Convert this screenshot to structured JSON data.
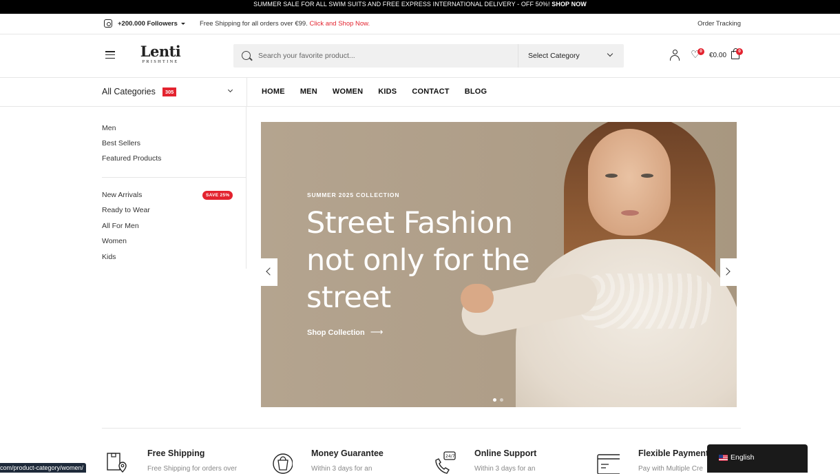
{
  "announcement": {
    "text": "SUMMER SALE FOR ALL SWIM SUITS AND FREE EXPRESS INTERNATIONAL DELIVERY - OFF 50%!",
    "cta": "SHOP NOW"
  },
  "infobar": {
    "followers": "+200.000 Followers",
    "shipping_text": "Free Shipping for all orders over €99.",
    "shipping_link": "Click and Shop Now.",
    "order_tracking": "Order Tracking"
  },
  "header": {
    "logo_main": "Lenti",
    "logo_sub": "PRISHTINE",
    "search_placeholder": "Search your favorite product...",
    "category_select": "Select Category",
    "wishlist_count": "0",
    "cart_total": "€0.00",
    "cart_count": "0"
  },
  "nav": {
    "all_categories": "All Categories",
    "category_count": "305",
    "menu": [
      "HOME",
      "MEN",
      "WOMEN",
      "KIDS",
      "CONTACT",
      "BLOG"
    ]
  },
  "sidebar": {
    "group1": [
      "Men",
      "Best Sellers",
      "Featured Products"
    ],
    "group2": [
      "New Arrivals",
      "Ready to Wear",
      "All For Men",
      "Women",
      "Kids"
    ],
    "save_badge": "SAVE 25%"
  },
  "hero": {
    "tag": "SUMMER 2025 COLLECTION",
    "title": "Street Fashion not only for the street",
    "cta": "Shop Collection",
    "slide_count": 2,
    "active_slide": 1
  },
  "features": [
    {
      "title": "Free Shipping",
      "subtitle": "Free Shipping for orders over",
      "icon": "delivery-box-icon"
    },
    {
      "title": "Money Guarantee",
      "subtitle": "Within 3 days for an",
      "icon": "money-bag-icon"
    },
    {
      "title": "Online Support",
      "subtitle": "Within 3 days for an",
      "icon": "support-phone-icon"
    },
    {
      "title": "Flexible Payment",
      "subtitle": "Pay with Multiple Cre",
      "icon": "credit-card-icon"
    }
  ],
  "status_url": "com/product-category/women/",
  "language": "English",
  "colors": {
    "accent": "#e3232f",
    "topbar": "#000000",
    "hero_bg": "#b0a089"
  }
}
